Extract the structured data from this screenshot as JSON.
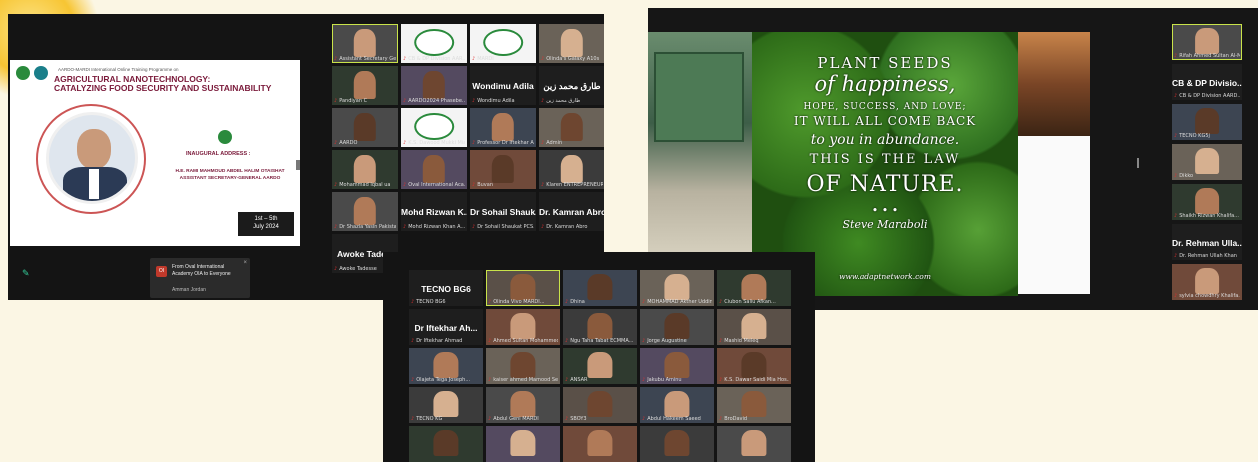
{
  "slide": {
    "program": "AARDO-MARDI International Online Training Programme on",
    "title_line1": "AGRICULTURAL NANOTECHNOLOGY:",
    "title_line2": "CATALYZING FOOD SECURITY AND SUSTAINABILITY",
    "inaugural": "INAUGURAL ADDRESS :",
    "person_name": "H.E. RAMI MAHMOUD ABDEL HALIM OTAISHAT",
    "person_role": "ASSISTANT SECRETARY-GENERAL AARDO",
    "dates_line1": "1st – 5th",
    "dates_line2": "July 2024"
  },
  "chat_notification": {
    "badge": "OI",
    "message": "From Oval International Academy OIA to Everyone",
    "sender": "Amman Jordan"
  },
  "window1_tiles": [
    {
      "caption": "Assistant Secretary Ge...",
      "type": "video"
    },
    {
      "caption": "CB & DP Division AAR...",
      "type": "logo"
    },
    {
      "caption": "MARDI",
      "type": "logo"
    },
    {
      "caption": "Olinda's Galaxy A10s",
      "type": "video"
    },
    {
      "caption": "Pandiyan C",
      "type": "video"
    },
    {
      "caption": "AARDO2024 Phasebe...",
      "type": "video"
    },
    {
      "caption": "Wondimu Adila",
      "type": "name",
      "big": "Wondimu Adila"
    },
    {
      "caption": "طارق محمد زين",
      "type": "name",
      "big": "طارق محمد زين"
    },
    {
      "caption": "AARDO",
      "type": "video"
    },
    {
      "caption": "K.S. Dawood Mukki Mia...",
      "type": "logo"
    },
    {
      "caption": "Professor Dr Iftekhar A...",
      "type": "video"
    },
    {
      "caption": "Admin",
      "type": "video"
    },
    {
      "caption": "Mohammad Iqbal ua",
      "type": "video"
    },
    {
      "caption": "Oval International Aca...",
      "type": "video"
    },
    {
      "caption": "Buvan",
      "type": "video"
    },
    {
      "caption": "Klaren ENTREPRENEUR",
      "type": "video"
    },
    {
      "caption": "Dr Shazia Yasin Pakistan",
      "type": "video"
    },
    {
      "caption": "Mohd Rizwan Khan A...",
      "type": "name",
      "big": "Mohd Rizwan K..."
    },
    {
      "caption": "Dr Sohail Shaukat PCS...",
      "type": "name",
      "big": "Dr Sohail Shauk..."
    },
    {
      "caption": "Dr. Kamran Abro",
      "type": "name",
      "big": "Dr. Kamran Abro"
    },
    {
      "caption": "Awoke Tadesse",
      "type": "name",
      "big": "Awoke Tade..."
    }
  ],
  "window2_right_tiles": [
    {
      "caption": "Rifah Ahmed Sultan Al-Mahri",
      "type": "video"
    },
    {
      "caption": "CB & DP Division AARD...",
      "type": "name",
      "big": "CB & DP Divisio..."
    },
    {
      "caption": "TECNO KG5j",
      "type": "video"
    },
    {
      "caption": "Dikko",
      "type": "video"
    },
    {
      "caption": "Shaikh Rizwan Khalifa...",
      "type": "video"
    },
    {
      "caption": "Dr. Rehman Ullah Khan",
      "type": "name",
      "big": "Dr. Rehman Ulla..."
    },
    {
      "caption": "sylvia chowdhry Khalifa...",
      "type": "video"
    }
  ],
  "quote": {
    "line1": "PLANT SEEDS",
    "line2": "of happiness,",
    "line3": "HOPE, SUCCESS, AND LOVE;",
    "line4": "IT WILL ALL COME BACK",
    "line5": "to you in abundance.",
    "line6": "THIS IS THE LAW",
    "line7": "OF NATURE.",
    "author": "Steve Maraboli",
    "url": "www.adaptnetwork.com"
  },
  "window3_tiles": [
    {
      "caption": "TECNO BG6",
      "type": "name",
      "big": "TECNO BG6"
    },
    {
      "caption": "Olinda Vivo MARDI...",
      "type": "video"
    },
    {
      "caption": "Dhina",
      "type": "video"
    },
    {
      "caption": "MOHAMMAD Akther Uddin...",
      "type": "video"
    },
    {
      "caption": "Ciubon Saliu Afkan...",
      "type": "video"
    },
    {
      "caption": "Dr Iftekhar Ahmad",
      "type": "name",
      "big": "Dr Iftekhar Ah..."
    },
    {
      "caption": "Ahmed Sultan Mohammed...",
      "type": "video"
    },
    {
      "caption": "Ngu Taha Tabat ECMMA...",
      "type": "video"
    },
    {
      "caption": "Jorge Augustine",
      "type": "video"
    },
    {
      "caption": "Mashid Meleq",
      "type": "video"
    },
    {
      "caption": "Olajeta Tega Joseph...",
      "type": "video"
    },
    {
      "caption": "kaiser ahmed Mamood Sen...",
      "type": "video"
    },
    {
      "caption": "ANSAR",
      "type": "video"
    },
    {
      "caption": "Jakubu Aminu",
      "type": "video"
    },
    {
      "caption": "K.S. Dawar Saidi Mia Hos...",
      "type": "video"
    },
    {
      "caption": "TECNO KG",
      "type": "video"
    },
    {
      "caption": "Abdul Geni MARDI",
      "type": "video"
    },
    {
      "caption": "SBOY3",
      "type": "video"
    },
    {
      "caption": "Abdul Hakeem Saeed",
      "type": "video"
    },
    {
      "caption": "BroDavid",
      "type": "video"
    },
    {
      "caption": "",
      "type": "video"
    },
    {
      "caption": "",
      "type": "video"
    },
    {
      "caption": "",
      "type": "video"
    },
    {
      "caption": "",
      "type": "video"
    },
    {
      "caption": "",
      "type": "video"
    }
  ],
  "colors": {
    "background": "#fbf6e4",
    "window": "#141414",
    "tile": "#2a2a2a",
    "active_border": "#c9e34a",
    "slide_title": "#7a1a3a"
  }
}
